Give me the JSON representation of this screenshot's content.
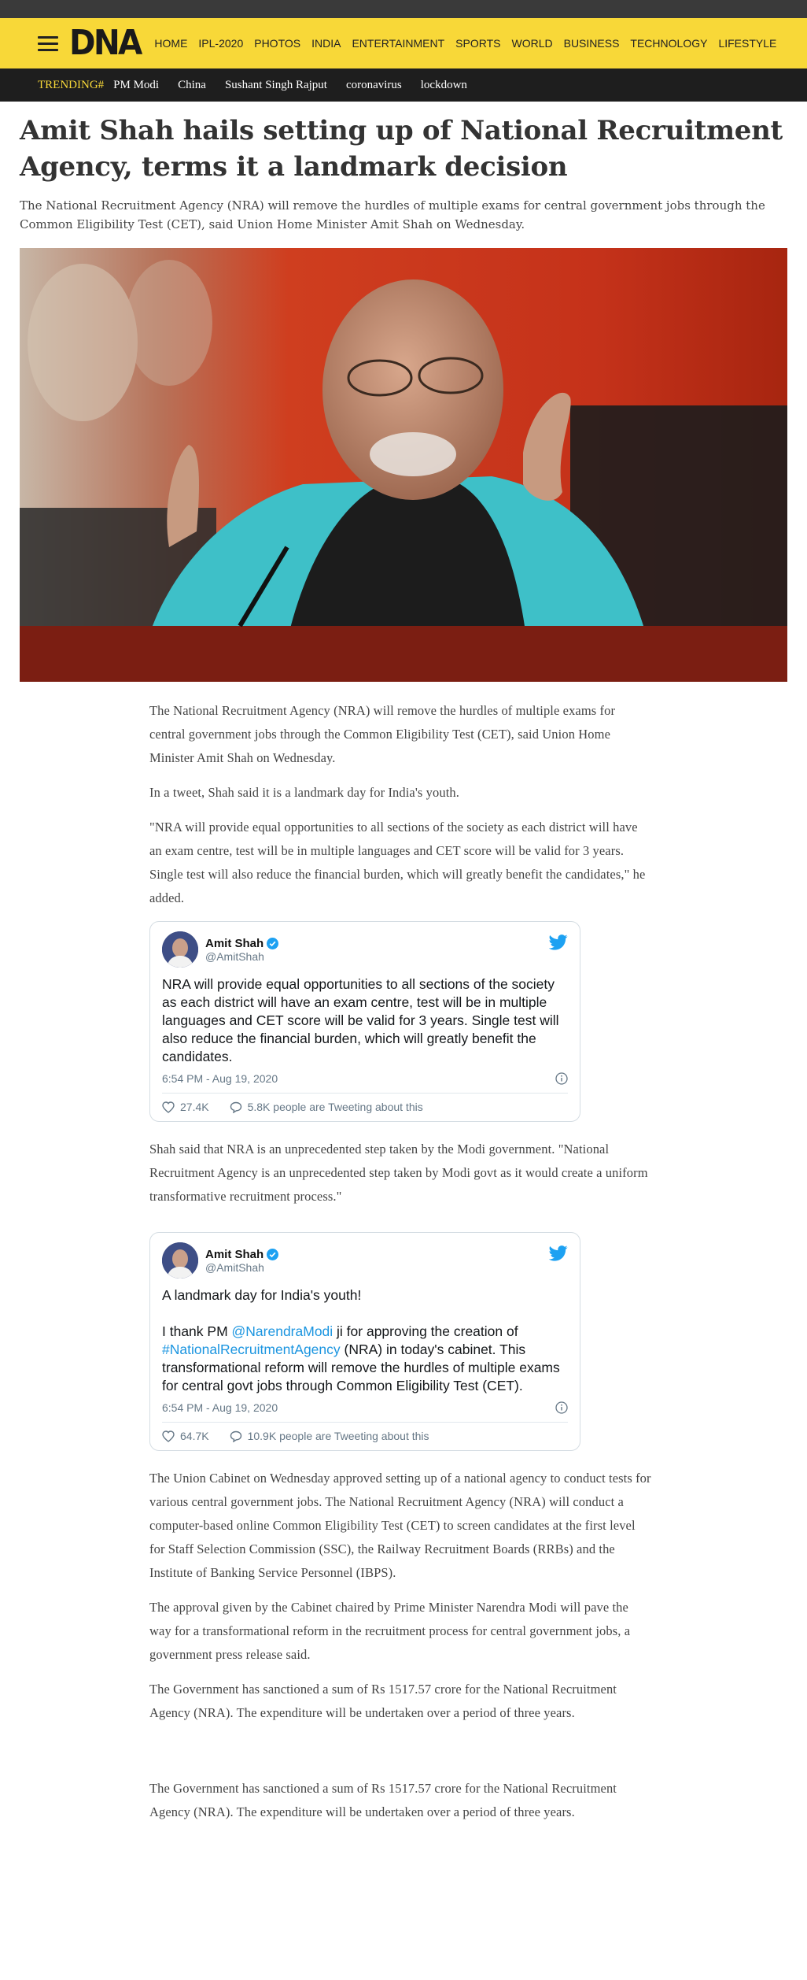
{
  "header": {
    "logo": "DNA",
    "nav": [
      "HOME",
      "IPL-2020",
      "PHOTOS",
      "INDIA",
      "ENTERTAINMENT",
      "SPORTS",
      "WORLD",
      "BUSINESS",
      "TECHNOLOGY",
      "LIFESTYLE"
    ]
  },
  "trending": {
    "label": "TRENDING#",
    "items": [
      "PM Modi",
      "China",
      "Sushant Singh Rajput",
      "coronavirus",
      "lockdown"
    ]
  },
  "article": {
    "headline": "Amit Shah hails setting up of National Recruitment Agency, terms it a landmark decision",
    "summary": "The National Recruitment Agency (NRA) will remove the hurdles of multiple exams for central government jobs through the Common Eligibility Test (CET), said Union Home Minister Amit Shah on Wednesday.",
    "paragraphs": [
      "The National Recruitment Agency (NRA) will remove the hurdles of multiple exams for central government jobs through the Common Eligibility Test (CET), said Union Home Minister Amit Shah on Wednesday.",
      "In a tweet, Shah said it is a landmark day for India's youth.",
      "\"NRA will provide equal opportunities to all sections of the society as each district will have an exam centre, test will be in multiple languages and CET score will be valid for 3 years. Single test will also reduce the financial burden, which will greatly benefit the candidates,\" he added.",
      "Shah said that NRA is an unprecedented step taken by the Modi government. \"National Recruitment Agency is an unprecedented step taken by Modi govt as it would create a uniform transformative recruitment process.\"",
      "The Union Cabinet on Wednesday approved setting up of a national agency to conduct tests for various central government jobs. The National Recruitment Agency (NRA) will conduct a computer-based online Common Eligibility Test (CET) to screen candidates at the first level for Staff Selection Commission (SSC), the Railway Recruitment Boards (RRBs) and the Institute of Banking Service Personnel (IBPS).",
      "The approval given by the Cabinet chaired by Prime Minister Narendra Modi will pave the way for a transformational reform in the recruitment process for central government jobs, a government press release said.",
      "The Government has sanctioned a sum of Rs 1517.57 crore for the National Recruitment Agency (NRA). The expenditure will be undertaken over a period of three years.",
      "The Government has sanctioned a sum of Rs 1517.57 crore for the National Recruitment Agency (NRA). The expenditure will be undertaken over a period of three years."
    ]
  },
  "tweets": [
    {
      "name": "Amit Shah",
      "handle": "@AmitShah",
      "text": "NRA will provide equal opportunities to all sections of the society as each district will have an exam centre, test will be in multiple languages and CET score will be valid for 3 years. Single test will also reduce the financial burden, which will greatly benefit the candidates.",
      "time": "6:54 PM - Aug 19, 2020",
      "likes": "27.4K",
      "replies": "5.8K people are Tweeting about this"
    },
    {
      "name": "Amit Shah",
      "handle": "@AmitShah",
      "text_line1": "A landmark day for India's youth!",
      "text_pre": "I thank PM ",
      "text_mention": "@NarendraModi",
      "text_mid": " ji for approving the creation of ",
      "text_hashtag": "#NationalRecruitmentAgency",
      "text_post": " (NRA) in today's cabinet. This transformational reform will remove the hurdles of multiple exams for central govt jobs through Common Eligibility Test (CET).",
      "time": "6:54 PM - Aug 19, 2020",
      "likes": "64.7K",
      "replies": "10.9K people are Tweeting about this"
    }
  ],
  "colors": {
    "header_bg": "#f8d838",
    "trending_bg": "#1e1e1e",
    "trending_label": "#f8d838",
    "twitter_blue": "#1da1f2"
  }
}
